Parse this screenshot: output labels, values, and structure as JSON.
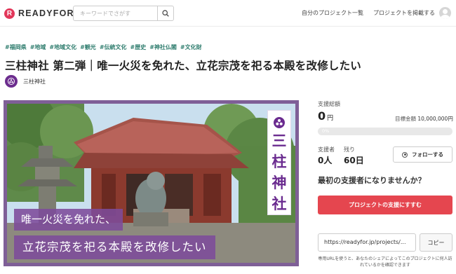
{
  "header": {
    "logo_letter": "R",
    "logo_text": "READYFOR",
    "search_placeholder": "キーワードでさがす",
    "search_icon": "search-icon",
    "nav": [
      "自分のプロジェクト一覧",
      "プロジェクトを掲載する"
    ],
    "avatar_icon": "user-avatar-icon"
  },
  "tags": [
    "#福岡県",
    "#地域",
    "#地域文化",
    "#観光",
    "#伝統文化",
    "#歴史",
    "#神社仏閣",
    "#文化財"
  ],
  "title": "三柱神社 第二弾｜唯一火災を免れた、立花宗茂を祀る本殿を改修したい",
  "owner": {
    "name": "三柱神社"
  },
  "hero": {
    "vertical_text": [
      "三",
      "柱",
      "神",
      "社"
    ],
    "caption_line1": "唯一火災を免れた、",
    "caption_line2": "立花宗茂を祀る本殿を改修したい"
  },
  "sidebar": {
    "total_label": "支援総額",
    "total_value": "0",
    "total_unit": "円",
    "goal_label": "目標金額",
    "goal_value": "10,000,000円",
    "progress_percent": 0,
    "progress_text": "0%",
    "supporters_label": "支援者",
    "supporters_value": "0人",
    "remaining_label": "残り",
    "remaining_value": "60日",
    "follow_label": "フォローする",
    "question": "最初の支援者になりませんか？",
    "support_button": "プロジェクトの支援にすすむ",
    "share_url": "https://readyfor.jp/projects/...",
    "copy_button": "コピー",
    "share_note": "専用URLを使うと、あなたのシェアによってこのプロジェクトに何人訪れているかを確認できます"
  },
  "colors": {
    "brand": "#e2375a",
    "accent_purple": "#7f5f97",
    "cta": "#e5464f",
    "tag": "#2f7d6e"
  }
}
